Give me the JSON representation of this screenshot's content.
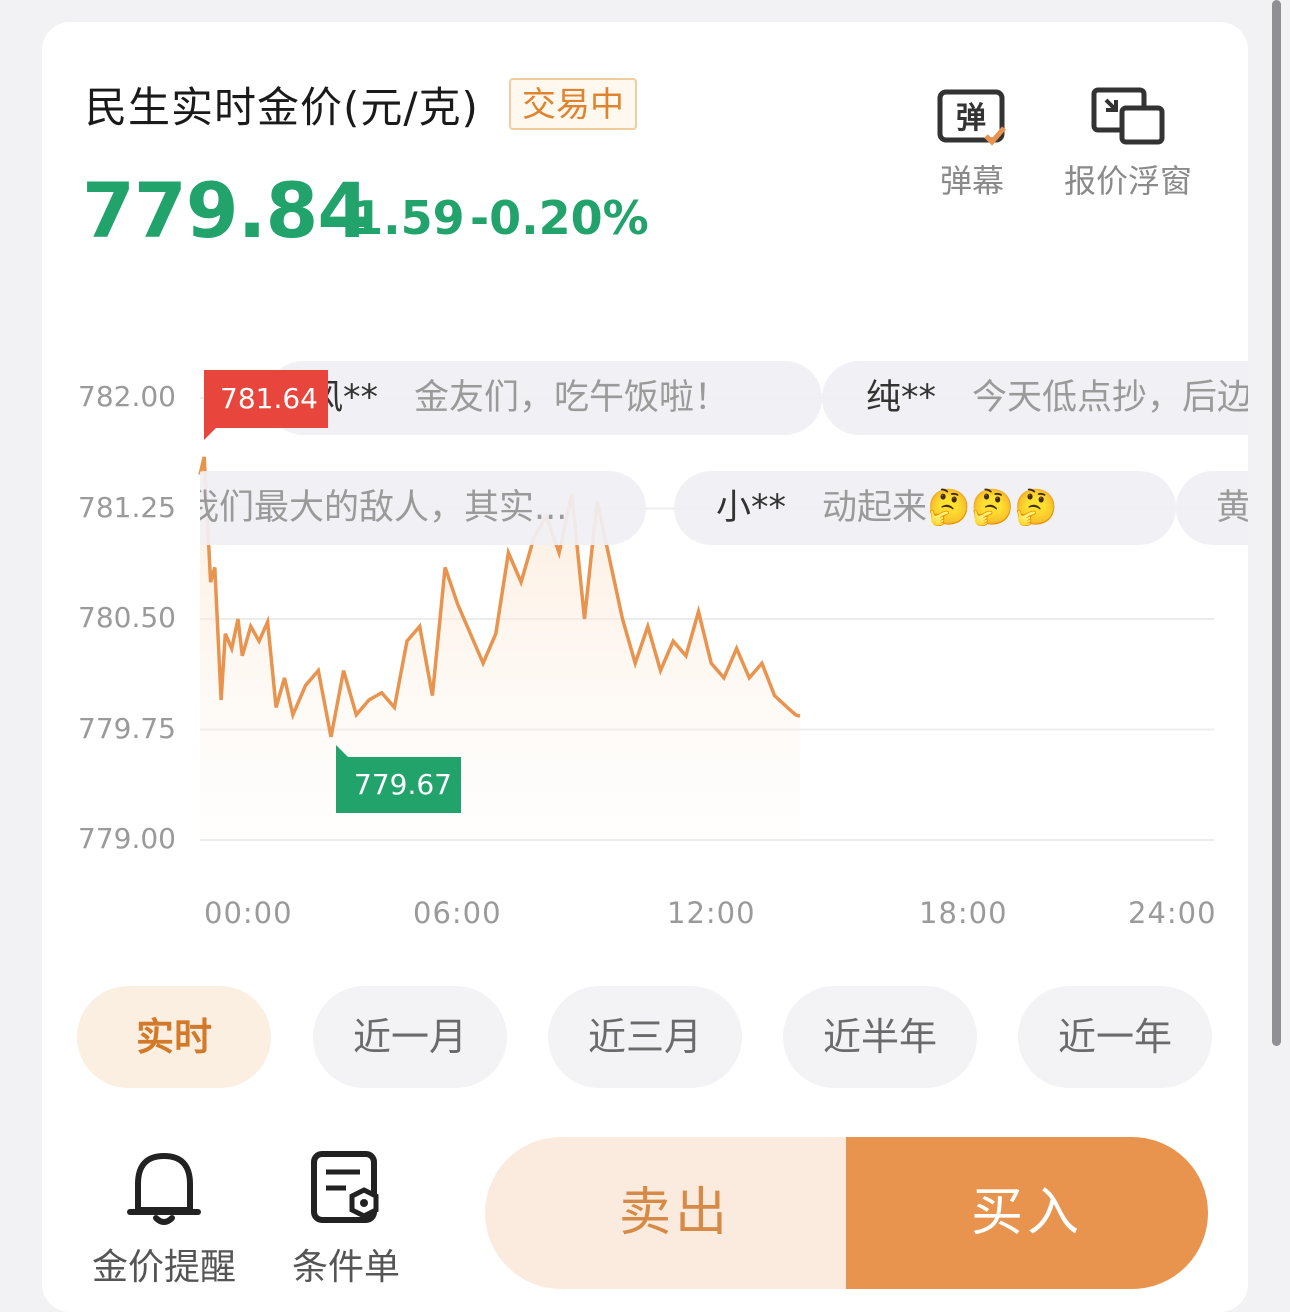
{
  "header": {
    "title": "民生实时金价(元/克)",
    "status": "交易中",
    "price": "779.84",
    "change": "-1.59",
    "change_pct": "-0.20%",
    "tools": [
      {
        "label": "弹幕",
        "icon": "danmaku-icon"
      },
      {
        "label": "报价浮窗",
        "icon": "floating-window-icon"
      }
    ]
  },
  "chart_data": {
    "type": "line",
    "y_ticks": [
      "782.00",
      "781.25",
      "780.50",
      "779.75",
      "779.00"
    ],
    "x_ticks": [
      "00:00",
      "06:00",
      "12:00",
      "18:00",
      "24:00"
    ],
    "ylim": [
      779.0,
      782.0
    ],
    "xlim": [
      0,
      24
    ],
    "high_label": "781.64",
    "low_label": "779.67",
    "series": [
      {
        "x": [
          0,
          0.1,
          0.25,
          0.35,
          0.5,
          0.6,
          0.75,
          0.9,
          1.0,
          1.2,
          1.4,
          1.6,
          1.8,
          2.0,
          2.2,
          2.5,
          2.8,
          3.1,
          3.4,
          3.7,
          4.0,
          4.3,
          4.6,
          4.9,
          5.2,
          5.5,
          5.8,
          6.1,
          6.4,
          6.7,
          7.0,
          7.3,
          7.6,
          7.9,
          8.2,
          8.5,
          8.8,
          9.1,
          9.4,
          9.7,
          10.0,
          10.3,
          10.6,
          10.9,
          11.2,
          11.5,
          11.8,
          12.1,
          12.4,
          12.7,
          13.0,
          13.3,
          13.6,
          13.9,
          14.1,
          14.2
        ],
        "y": [
          781.48,
          781.6,
          780.75,
          780.85,
          779.95,
          780.4,
          780.3,
          780.5,
          780.25,
          780.45,
          780.35,
          780.48,
          779.9,
          780.1,
          779.85,
          780.05,
          780.15,
          779.7,
          780.15,
          779.85,
          779.95,
          780.0,
          779.9,
          780.35,
          780.45,
          779.98,
          780.85,
          780.6,
          780.4,
          780.2,
          780.4,
          780.95,
          780.75,
          781.05,
          781.2,
          780.95,
          781.35,
          780.5,
          781.3,
          780.9,
          780.5,
          780.2,
          780.45,
          780.15,
          780.35,
          780.25,
          780.55,
          780.2,
          780.1,
          780.3,
          780.1,
          780.2,
          779.98,
          779.9,
          779.85,
          779.84
        ]
      }
    ]
  },
  "danmaku": [
    {
      "user": "风**",
      "text": "金友们，吃午饭啦！"
    },
    {
      "user": "纯**",
      "text": "今天低点抄，后边"
    },
    {
      "user": "",
      "text": "我们最大的敌人，其实..."
    },
    {
      "user": "小**",
      "text": "动起来🤔🤔🤔"
    },
    {
      "user": "",
      "text": "黄"
    }
  ],
  "ranges": [
    {
      "label": "实时",
      "active": true
    },
    {
      "label": "近一月",
      "active": false
    },
    {
      "label": "近三月",
      "active": false
    },
    {
      "label": "近半年",
      "active": false
    },
    {
      "label": "近一年",
      "active": false
    }
  ],
  "footer": {
    "tools": [
      {
        "label": "金价提醒",
        "icon": "bell-icon"
      },
      {
        "label": "条件单",
        "icon": "condition-order-icon"
      }
    ],
    "sell": "卖出",
    "buy": "买入"
  },
  "colors": {
    "up_green": "#21a36b",
    "line_orange": "#e8944f",
    "high_red": "#e8453c",
    "accent": "#e8944f"
  }
}
